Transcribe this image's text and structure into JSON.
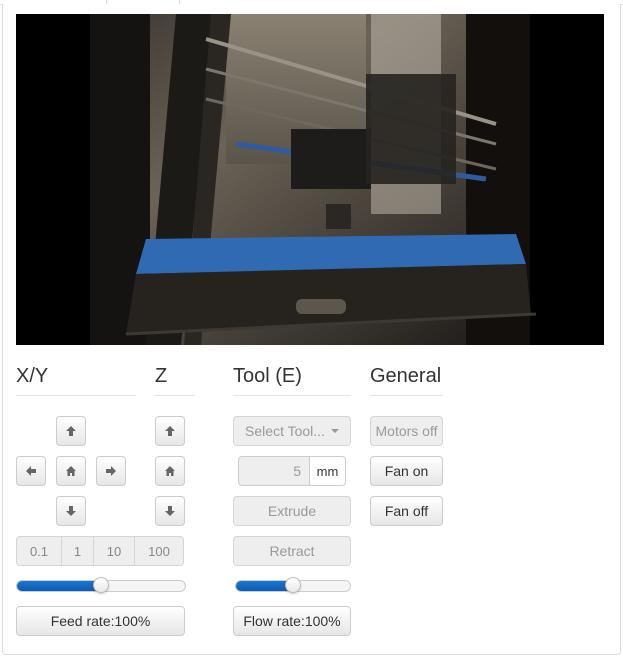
{
  "sections": {
    "xy": {
      "title": "X/Y"
    },
    "z": {
      "title": "Z"
    },
    "tool": {
      "title": "Tool (E)"
    },
    "general": {
      "title": "General"
    }
  },
  "jog_xy": {
    "step_sizes": [
      "0.1",
      "1",
      "10",
      "100"
    ],
    "feed_rate_label": "Feed rate:100%",
    "feed_rate_slider_fraction": 0.5
  },
  "tool": {
    "select_label": "Select Tool...",
    "amount_value": "5",
    "amount_unit": "mm",
    "extrude_label": "Extrude",
    "retract_label": "Retract",
    "flow_rate_label": "Flow rate:100%",
    "flow_rate_slider_fraction": 0.5
  },
  "general": {
    "motors_off_label": "Motors off",
    "fan_on_label": "Fan on",
    "fan_off_label": "Fan off"
  },
  "colors": {
    "slider_fill": "#0d5bb3",
    "heading": "#333333",
    "disabled_text": "#999999"
  },
  "icons": [
    "arrow-up-icon",
    "arrow-down-icon",
    "arrow-left-icon",
    "arrow-right-icon",
    "home-icon",
    "caret-down-icon"
  ]
}
